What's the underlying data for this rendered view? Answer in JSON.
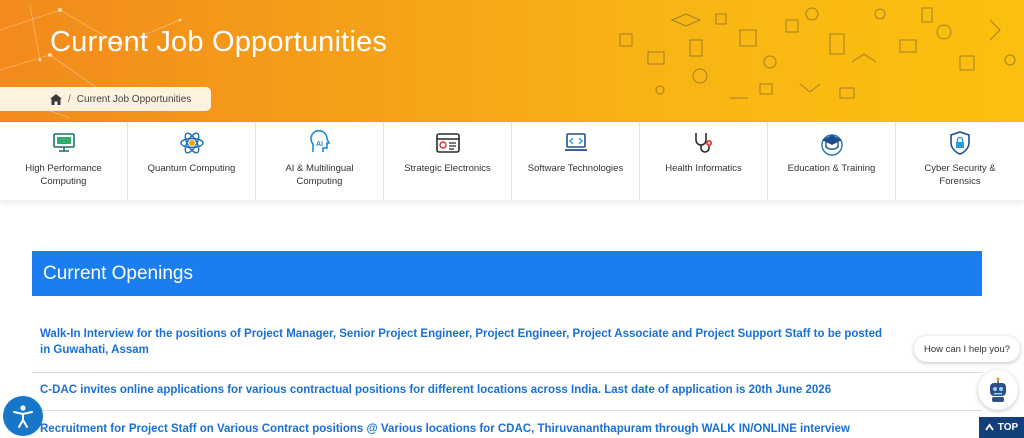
{
  "hero": {
    "title": "Current Job Opportunities",
    "breadcrumb": {
      "home_icon": "home-icon",
      "separator": "/",
      "current": "Current Job Opportunities"
    }
  },
  "categories": [
    {
      "label": "High Performance Computing",
      "icon": "hpc-monitor-icon"
    },
    {
      "label": "Quantum Computing",
      "icon": "atom-icon"
    },
    {
      "label": "AI & Multilingual Computing",
      "icon": "ai-head-icon"
    },
    {
      "label": "Strategic Electronics",
      "icon": "electronics-panel-icon"
    },
    {
      "label": "Software Technologies",
      "icon": "code-laptop-icon"
    },
    {
      "label": "Health Informatics",
      "icon": "stethoscope-icon"
    },
    {
      "label": "Education & Training",
      "icon": "graduation-cap-icon"
    },
    {
      "label": "Cyber Security & Forensics",
      "icon": "shield-lock-icon"
    }
  ],
  "openings": {
    "title": "Current Openings",
    "jobs": [
      "Walk-In Interview for the positions of Project Manager, Senior Project Engineer, Project Engineer, Project Associate and Project Support Staff to be posted in Guwahati, Assam",
      "C-DAC invites online applications for various contractual positions for different locations across India. Last date of application is 20th June 2026",
      "Recruitment for Project Staff on Various Contract positions @ Various locations for CDAC, Thiruvananthapuram through WALK IN/ONLINE interview"
    ]
  },
  "widgets": {
    "chat_prompt": "How can I help you?",
    "top_label": "TOP"
  },
  "colors": {
    "hero_start": "#f28a1c",
    "hero_end": "#fbc00f",
    "accent_blue": "#1a7ef0",
    "link_blue": "#1a6fd8",
    "top_button": "#13407a"
  }
}
